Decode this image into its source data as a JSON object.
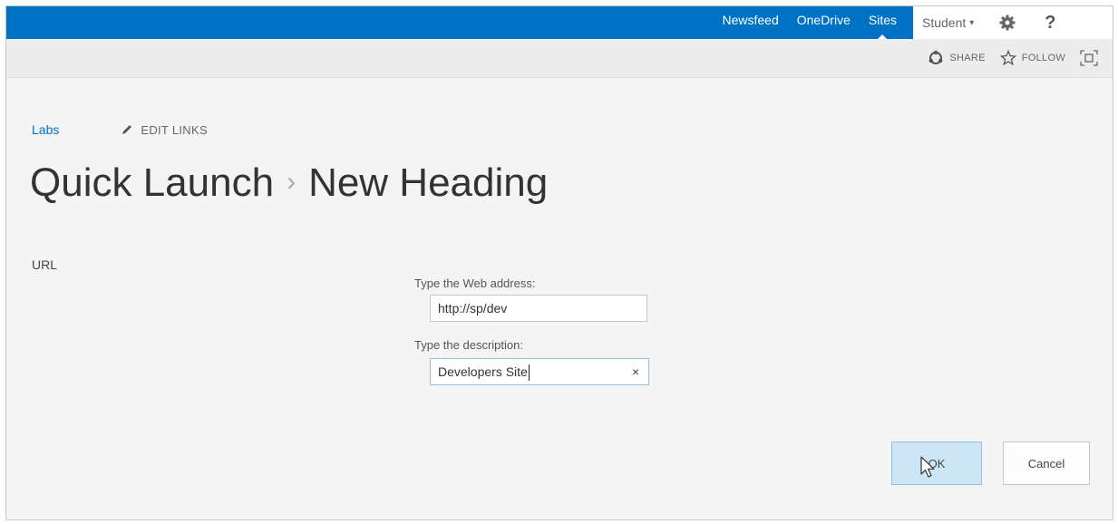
{
  "suite_bar": {
    "links": [
      {
        "label": "Newsfeed"
      },
      {
        "label": "OneDrive"
      },
      {
        "label": "Sites"
      }
    ],
    "user": "Student",
    "help": "?",
    "accent": "#0072c6"
  },
  "command_bar": {
    "share": "SHARE",
    "follow": "FOLLOW"
  },
  "breadcrumb": {
    "site_link": "Labs",
    "edit_links": "EDIT LINKS"
  },
  "title": {
    "part1": "Quick Launch",
    "separator": "›",
    "part2": "New Heading"
  },
  "form": {
    "section_label": "URL",
    "web_address_label": "Type the Web address:",
    "web_address_value": "http://sp/dev",
    "description_label": "Type the description:",
    "description_value": "Developers Site",
    "clear": "×"
  },
  "buttons": {
    "ok": "OK",
    "cancel": "Cancel"
  }
}
